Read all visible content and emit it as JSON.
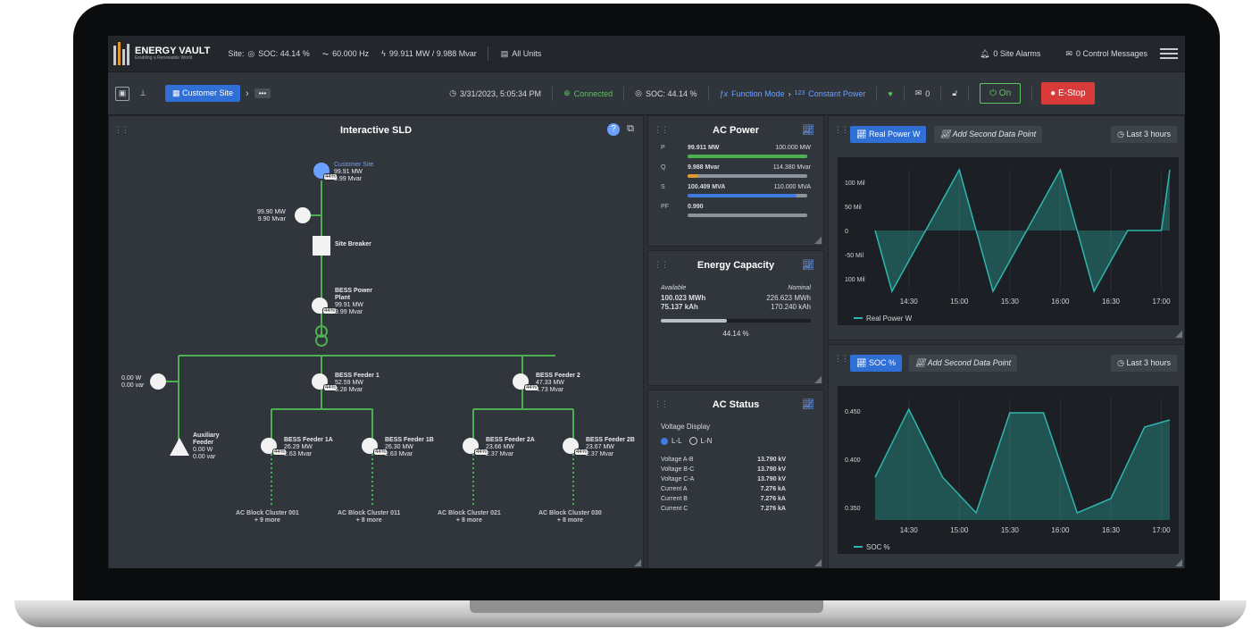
{
  "topbar": {
    "logo_name": "ENERGY VAULT",
    "logo_tagline": "Enabling a Renewable World",
    "site_label": "Site:",
    "soc": "SOC: 44.14 %",
    "frequency": "60.000 Hz",
    "power": "99.911 MW / 9.988 Mvar",
    "units": "All Units",
    "site_alarms": "0 Site Alarms",
    "control_messages": "0 Control Messages"
  },
  "secbar": {
    "crumb": "Customer Site",
    "more": "•••",
    "datetime": "3/31/2023, 5:05:34 PM",
    "connection": "Connected",
    "soc": "SOC: 44.14 %",
    "function_mode_label": "Function Mode",
    "function_mode_value": "Constant Power",
    "message_count": "0",
    "on_label": "On",
    "estop_label": "E-Stop"
  },
  "sld": {
    "title": "Interactive SLD",
    "customer_site": {
      "name": "Customer Site",
      "pct": "44%",
      "mw": "99.91 MW",
      "mvar": "9.99 Mvar"
    },
    "meter_top": {
      "mw": "99.90 MW",
      "mvar": "9.90 Mvar"
    },
    "site_breaker": "Site Breaker",
    "plant": {
      "name1": "BESS Power",
      "name2": "Plant",
      "pct": "44%",
      "mw": "99.91 MW",
      "mvar": "9.99 Mvar"
    },
    "meter_left": {
      "w": "0.00 W",
      "var": "0.00 var"
    },
    "feeder1": {
      "name": "BESS Feeder 1",
      "pct": "44%",
      "mw": "52.59 MW",
      "mvar": "5.28 Mvar"
    },
    "feeder2": {
      "name": "BESS Feeder 2",
      "pct": "44%",
      "mw": "47.33 MW",
      "mvar": "4.73 Mvar"
    },
    "aux": {
      "name1": "Auxiliary",
      "name2": "Feeder",
      "w": "0.00 W",
      "var": "0.00 var"
    },
    "f1a": {
      "name": "BESS Feeder 1A",
      "pct": "44%",
      "mw": "26.29 MW",
      "mvar": "2.63 Mvar"
    },
    "f1b": {
      "name": "BESS Feeder 1B",
      "pct": "44%",
      "mw": "26.30 MW",
      "mvar": "2.63 Mvar"
    },
    "f2a": {
      "name": "BESS Feeder 2A",
      "pct": "44%",
      "mw": "23.66 MW",
      "mvar": "2.37 Mvar"
    },
    "f2b": {
      "name": "BESS Feeder 2B",
      "pct": "44%",
      "mw": "23.67 MW",
      "mvar": "2.37 Mvar"
    },
    "clusters": [
      {
        "name": "AC Block Cluster 001",
        "more": "+ 9 more"
      },
      {
        "name": "AC Block Cluster 011",
        "more": "+ 8 more"
      },
      {
        "name": "AC Block Cluster 021",
        "more": "+ 8 more"
      },
      {
        "name": "AC Block Cluster 030",
        "more": "+ 8 more"
      }
    ]
  },
  "ac_power": {
    "title": "AC Power",
    "rows": [
      {
        "label": "P",
        "value": "99.911 MW",
        "max": "100.000 MW",
        "fill": 0.999,
        "color": "#4caf50"
      },
      {
        "label": "Q",
        "value": "9.988 Mvar",
        "max": "114.380 Mvar",
        "fill": 0.087,
        "color": "#e09a2c"
      },
      {
        "label": "S",
        "value": "100.409 MVA",
        "max": "110.000 MVA",
        "fill": 0.913,
        "color": "#3d7be0"
      },
      {
        "label": "PF",
        "value": "0.990",
        "max": "",
        "fill": 0,
        "color": "#8b949d"
      }
    ]
  },
  "energy": {
    "title": "Energy Capacity",
    "available_label": "Available",
    "nominal_label": "Nominal",
    "available_mwh": "100.023 MWh",
    "nominal_mwh": "226.623 MWh",
    "available_kah": "75.137 kAh",
    "nominal_kah": "170.240 kAh",
    "pct_text": "44.14 %",
    "fill": 0.4414
  },
  "ac_status": {
    "title": "AC Status",
    "voltage_display_label": "Voltage Display",
    "radio_ll": "L-L",
    "radio_ln": "L-N",
    "rows": [
      {
        "label": "Voltage A-B",
        "value": "13.790 kV"
      },
      {
        "label": "Voltage B-C",
        "value": "13.790 kV"
      },
      {
        "label": "Voltage C-A",
        "value": "13.790 kV"
      },
      {
        "label": "Current A",
        "value": "7.276 kA"
      },
      {
        "label": "Current B",
        "value": "7.276 kA"
      },
      {
        "label": "Current C",
        "value": "7.276 kA"
      }
    ]
  },
  "chart1_panel": {
    "chip": "Real Power W",
    "add": "Add Second Data Point",
    "range": "Last 3 hours"
  },
  "chart2_panel": {
    "chip": "SOC %",
    "add": "Add Second Data Point",
    "range": "Last 3 hours"
  },
  "chart_data": [
    {
      "type": "area",
      "series": [
        {
          "name": "Real Power W",
          "x": [
            "14:10",
            "14:20",
            "14:40",
            "15:00",
            "15:20",
            "15:40",
            "16:00",
            "16:20",
            "16:40",
            "17:00",
            "17:05"
          ],
          "values": [
            0,
            -100,
            0,
            100,
            -100,
            0,
            100,
            -100,
            0,
            0,
            100
          ]
        }
      ],
      "yticks": [
        "100 Mil",
        "50 Mil",
        "0",
        "-50 Mil",
        "100 Mil"
      ],
      "xticks": [
        "14:30",
        "15:00",
        "15:30",
        "16:00",
        "16:30",
        "17:00"
      ],
      "ylim": [
        -100,
        100
      ],
      "color": "#2fb5b0"
    },
    {
      "type": "area",
      "series": [
        {
          "name": "SOC %",
          "x": [
            "14:10",
            "14:30",
            "14:50",
            "15:10",
            "15:30",
            "15:50",
            "16:10",
            "16:30",
            "16:50",
            "17:05"
          ],
          "values": [
            0.36,
            0.455,
            0.36,
            0.31,
            0.45,
            0.45,
            0.31,
            0.33,
            0.43,
            0.44
          ]
        }
      ],
      "yticks": [
        "0.450",
        "0.400",
        "0.350"
      ],
      "xticks": [
        "14:30",
        "15:00",
        "15:30",
        "16:00",
        "16:30",
        "17:00"
      ],
      "ylim": [
        0.3,
        0.47
      ],
      "color": "#2fb5b0"
    }
  ]
}
